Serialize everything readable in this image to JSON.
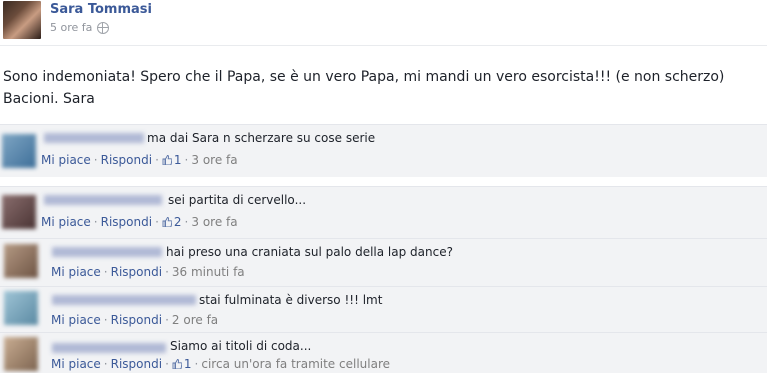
{
  "post": {
    "author": "Sara Tommasi",
    "time": "5 ore fa",
    "text": "Sono indemoniata! Spero che il Papa, se è un vero Papa, mi mandi un vero esorcista!!! (e non scherzo) Bacioni. Sara"
  },
  "actions": {
    "like": "Mi piace",
    "reply": "Rispondi"
  },
  "comments": [
    {
      "text": "ma dai Sara n scherzare su cose serie",
      "likes": "1",
      "time": "3 ore fa"
    },
    {
      "text": "sei partita di cervello...",
      "likes": "2",
      "time": "3 ore fa"
    },
    {
      "text": "hai preso una craniata sul palo della lap dance?",
      "likes": null,
      "time": "36 minuti fa"
    },
    {
      "text": "stai fulminata è diverso !!! lmt",
      "likes": null,
      "time": "2 ore fa"
    },
    {
      "text": "Siamo ai titoli di coda...",
      "likes": "1",
      "time": "circa un'ora fa tramite cellulare"
    }
  ],
  "colors": {
    "link": "#3b5998",
    "comment_bg": "#f2f3f5",
    "meta": "#90949c"
  },
  "icons": {
    "privacy": "globe-icon",
    "like": "thumbs-up-icon"
  }
}
